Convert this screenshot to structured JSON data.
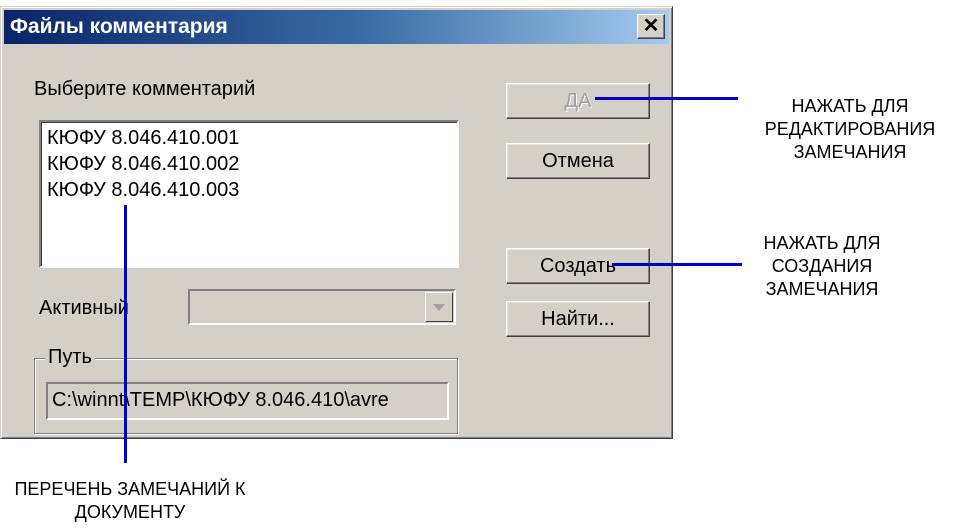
{
  "dialog": {
    "title": "Файлы комментария",
    "close_label": "✕",
    "list_label": "Выберите комментарий",
    "items": [
      "КЮФУ 8.046.410.001",
      "КЮФУ 8.046.410.002",
      "КЮФУ 8.046.410.003"
    ],
    "active_label": "Активный",
    "active_value": "",
    "path_group_label": "Путь",
    "path_value": "C:\\winnt\\TEMP\\КЮФУ 8.046.410\\avre"
  },
  "buttons": {
    "ok": "ДА",
    "cancel": "Отмена",
    "create": "Создать",
    "find": "Найти..."
  },
  "annotations": {
    "edit": [
      "НАЖАТЬ ДЛЯ",
      "РЕДАКТИРОВАНИЯ",
      "ЗАМЕЧАНИЯ"
    ],
    "create": [
      "НАЖАТЬ ДЛЯ",
      "СОЗДАНИЯ",
      "ЗАМЕЧАНИЯ"
    ],
    "list": [
      "ПЕРЕЧЕНЬ ЗАМЕЧАНИЙ К",
      "ДОКУМЕНТУ"
    ]
  },
  "colors": {
    "title_bar_start": "#0a246a",
    "title_bar_end": "#a6caf0",
    "dialog_face": "#d4d0c8",
    "callout_line": "#0000cc"
  }
}
